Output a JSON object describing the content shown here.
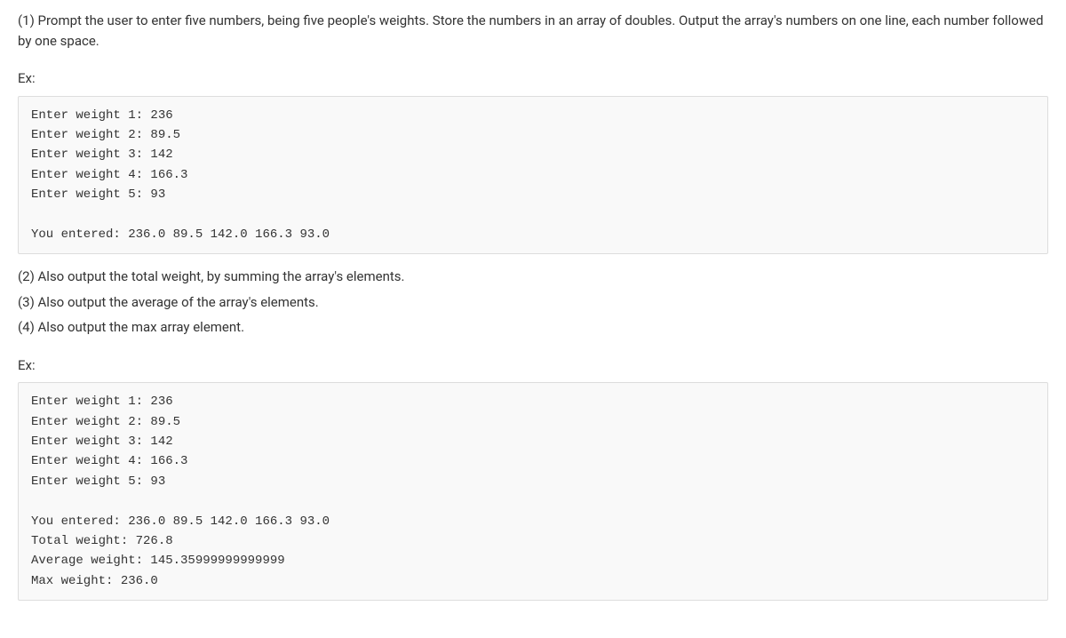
{
  "step1": "(1) Prompt the user to enter five numbers, being five people's weights. Store the numbers in an array of doubles. Output the array's numbers on one line, each number followed by one space.",
  "ex_label_1": "Ex:",
  "code1": "Enter weight 1: 236\nEnter weight 2: 89.5\nEnter weight 3: 142\nEnter weight 4: 166.3\nEnter weight 5: 93\n\nYou entered: 236.0 89.5 142.0 166.3 93.0",
  "step2": "(2) Also output the total weight, by summing the array's elements.",
  "step3": "(3) Also output the average of the array's elements.",
  "step4": "(4) Also output the max array element.",
  "ex_label_2": "Ex:",
  "code2": "Enter weight 1: 236\nEnter weight 2: 89.5\nEnter weight 3: 142\nEnter weight 4: 166.3\nEnter weight 5: 93\n\nYou entered: 236.0 89.5 142.0 166.3 93.0\nTotal weight: 726.8\nAverage weight: 145.35999999999999\nMax weight: 236.0"
}
